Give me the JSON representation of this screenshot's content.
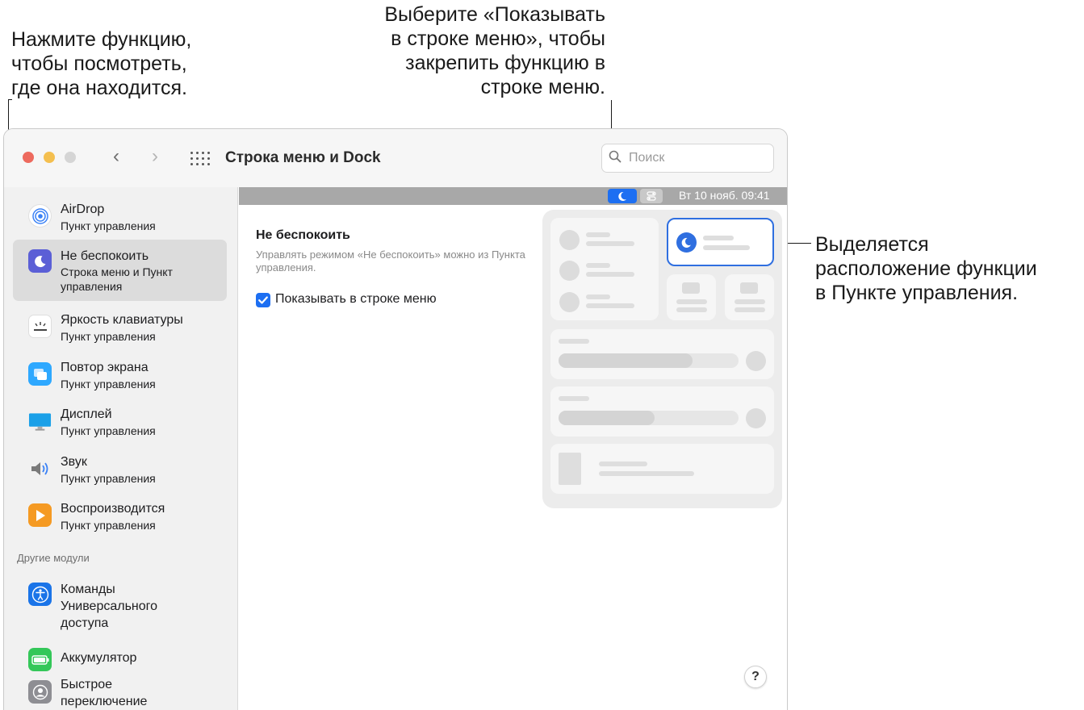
{
  "callouts": {
    "left": "Нажмите функцию,\nчтобы посмотреть,\nгде она находится.",
    "top": "Выберите «Показывать\nв строке меню», чтобы\nзакрепить функцию в\nстроке меню.",
    "right": "Выделяется\nрасположение функции\nв Пункте управления."
  },
  "window": {
    "title": "Строка меню и Dock",
    "back_label": "‹",
    "forward_label": "›",
    "search_placeholder": "Поиск"
  },
  "sidebar": {
    "items": [
      {
        "title": "AirDrop",
        "subtitle": "Пункт управления",
        "icon": "airdrop-icon"
      },
      {
        "title": "Не беспокоить",
        "subtitle": "Строка меню и Пункт управления",
        "icon": "moon-icon"
      },
      {
        "title": "Яркость клавиатуры",
        "subtitle": "Пункт управления",
        "icon": "keyboard-brightness-icon"
      },
      {
        "title": "Повтор экрана",
        "subtitle": "Пункт управления",
        "icon": "screen-mirroring-icon"
      },
      {
        "title": "Дисплей",
        "subtitle": "Пункт управления",
        "icon": "display-icon"
      },
      {
        "title": "Звук",
        "subtitle": "Пункт управления",
        "icon": "speaker-icon"
      },
      {
        "title": "Воспроизводится",
        "subtitle": "Пункт управления",
        "icon": "now-playing-icon"
      }
    ],
    "section_other": "Другие модули",
    "other_items": [
      {
        "title": "Команды Универсального доступа",
        "icon": "accessibility-icon"
      },
      {
        "title": "Аккумулятор",
        "icon": "battery-icon"
      },
      {
        "title": "Быстрое переключение",
        "icon": "fast-user-switching-icon"
      }
    ]
  },
  "menubar": {
    "clock": "Вт 10 нояб.  09:41"
  },
  "main": {
    "section_title": "Не беспокоить",
    "section_desc": "Управлять режимом «Не беспокоить» можно из Пункта управления.",
    "checkbox_label": "Показывать в строке меню",
    "checkbox_checked": true,
    "help_label": "?"
  },
  "colors": {
    "accent": "#1d6ff2",
    "selected_bg": "#dcdcdc"
  }
}
